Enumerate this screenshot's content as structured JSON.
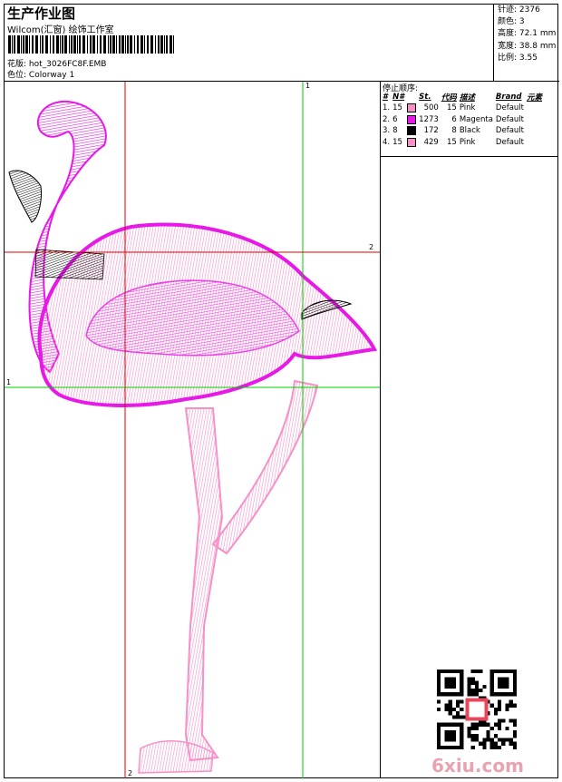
{
  "header": {
    "title": "生产作业图",
    "vendor": "Wilcom(汇窗) 绘饰工作室",
    "file_label": "花版:",
    "file_name": "hot_3026FC8F.EMB",
    "colorway_label": "色位:",
    "colorway_name": "Colorway 1"
  },
  "specs": [
    {
      "label": "针迹:",
      "value": "2376"
    },
    {
      "label": "颜色:",
      "value": "3"
    },
    {
      "label": "高度:",
      "value": "72.1 mm"
    },
    {
      "label": "宽度:",
      "value": "38.8 mm"
    },
    {
      "label": "比例:",
      "value": "3.55"
    }
  ],
  "stop_sequence": {
    "title": "停止顺序:",
    "headers": [
      "#",
      "N#",
      "St.",
      "代码",
      "描述",
      "Brand",
      "元素"
    ],
    "rows": [
      {
        "index": "1.",
        "needle": "15",
        "stitches": "500",
        "code": "15",
        "description": "Pink",
        "brand": "Default",
        "swatch": "#f690c8"
      },
      {
        "index": "2.",
        "needle": "6",
        "stitches": "1273",
        "code": "6",
        "description": "Magenta",
        "brand": "Default",
        "swatch": "#e619e6"
      },
      {
        "index": "3.",
        "needle": "8",
        "stitches": "172",
        "code": "8",
        "description": "Black",
        "brand": "Default",
        "swatch": "#000000"
      },
      {
        "index": "4.",
        "needle": "15",
        "stitches": "429",
        "code": "15",
        "description": "Pink",
        "brand": "Default",
        "swatch": "#f690c8"
      }
    ]
  },
  "guides": {
    "green_v": "1",
    "green_h": "1",
    "red_h": "2",
    "red_v": "2"
  },
  "watermark": "6xiu.com",
  "colors": {
    "pink": "#f690c8",
    "magenta": "#e619e6",
    "black": "#000000",
    "red_guide": "#e00000",
    "green_guide": "#00cc00"
  }
}
